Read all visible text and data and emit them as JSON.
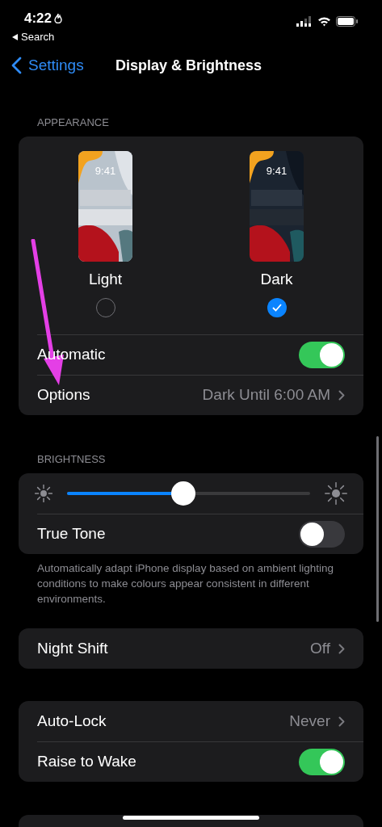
{
  "status_bar": {
    "time": "4:22",
    "back_label": "Search"
  },
  "nav": {
    "back": "Settings",
    "title": "Display & Brightness"
  },
  "appearance": {
    "header": "APPEARANCE",
    "modes": [
      {
        "kind": "light",
        "label": "Light",
        "preview_time": "9:41",
        "selected": false
      },
      {
        "kind": "dark",
        "label": "Dark",
        "preview_time": "9:41",
        "selected": true
      }
    ],
    "automatic": {
      "label": "Automatic",
      "on": true
    },
    "options": {
      "label": "Options",
      "value": "Dark Until 6:00 AM"
    }
  },
  "annotation": {
    "kind": "arrow",
    "color": "#e43fe6"
  },
  "brightness": {
    "header": "BRIGHTNESS",
    "level": 0.48,
    "true_tone": {
      "label": "True Tone",
      "on": false
    },
    "footer": "Automatically adapt iPhone display based on ambient lighting conditions to make colours appear consistent in different environments."
  },
  "groups": [
    {
      "rows": [
        {
          "kind": "link",
          "label": "Night Shift",
          "value": "Off"
        }
      ]
    },
    {
      "rows": [
        {
          "kind": "link",
          "label": "Auto-Lock",
          "value": "Never"
        },
        {
          "kind": "toggle",
          "label": "Raise to Wake",
          "on": true
        }
      ]
    }
  ]
}
